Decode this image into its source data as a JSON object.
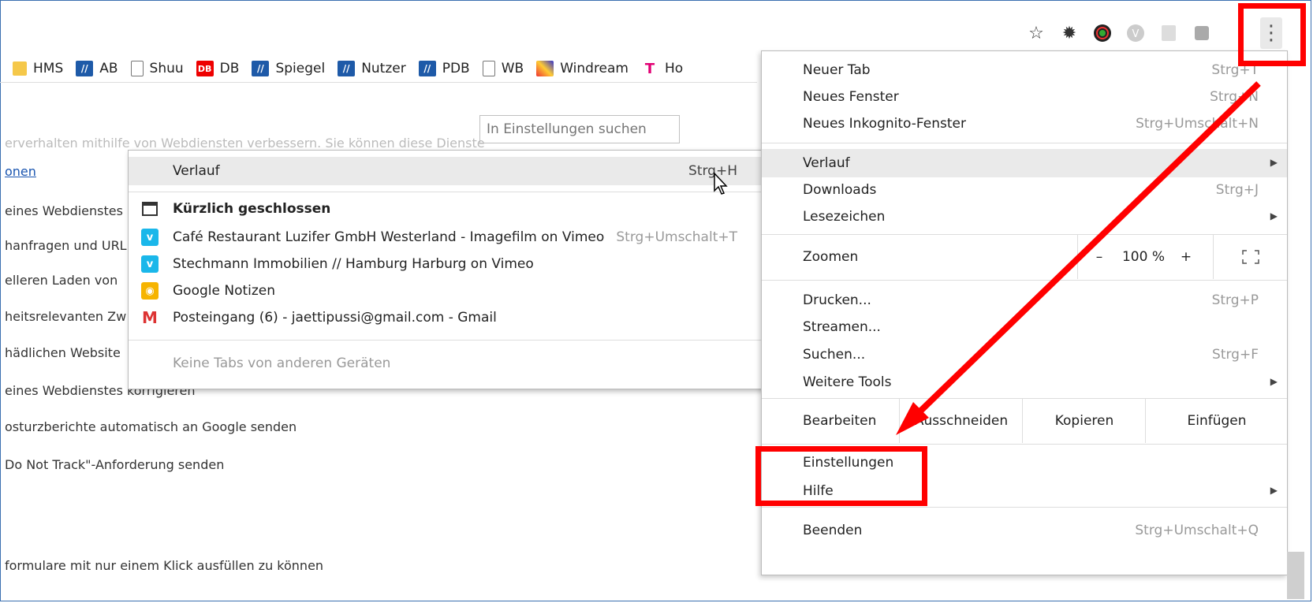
{
  "toolbar": {
    "icons": [
      "star-icon",
      "gear-icon",
      "color-wheel-icon",
      "extension-v-icon",
      "extension-keep-icon",
      "extension-square-icon"
    ],
    "menu_icon": "three-dots-icon"
  },
  "bookmarks": [
    {
      "label": "HMS",
      "icon": "folder-icon"
    },
    {
      "label": "AB",
      "icon": "ab-icon"
    },
    {
      "label": "Shuu",
      "icon": "page-icon"
    },
    {
      "label": "DB",
      "icon": "db-icon"
    },
    {
      "label": "Spiegel",
      "icon": "ab-icon"
    },
    {
      "label": "Nutzer",
      "icon": "ab-icon"
    },
    {
      "label": "PDB",
      "icon": "ab-icon"
    },
    {
      "label": "WB",
      "icon": "page-icon"
    },
    {
      "label": "Windream",
      "icon": "windream-icon"
    },
    {
      "label": "Ho",
      "icon": "telekom-icon"
    }
  ],
  "settings": {
    "search_placeholder": "In Einstellungen suchen",
    "lines": [
      "erverhalten mithilfe von Webdiensten verbessern. Sie können diese Dienste",
      "onen",
      "eines Webdienstes",
      "hanfragen und URL",
      "elleren Laden von",
      "heitsrelevanten Zw",
      "hädlichen Website",
      "eines Webdienstes korrigieren",
      "osturzberichte automatisch an Google senden",
      "Do Not Track\"-Anforderung senden",
      "formulare mit nur einem Klick ausfüllen zu können"
    ]
  },
  "history_submenu": {
    "header_label": "Verlauf",
    "header_shortcut": "Strg+H",
    "recently_closed_label": "Kürzlich geschlossen",
    "items": [
      {
        "label": "Café Restaurant Luzifer GmbH Westerland - Imagefilm on Vimeo",
        "shortcut": "Strg+Umschalt+T",
        "icon": "vimeo-icon"
      },
      {
        "label": "Stechmann Immobilien // Hamburg Harburg on Vimeo",
        "shortcut": "",
        "icon": "vimeo-icon"
      },
      {
        "label": "Google Notizen",
        "shortcut": "",
        "icon": "keep-icon"
      },
      {
        "label": "Posteingang (6) - jaettipussi@gmail.com - Gmail",
        "shortcut": "",
        "icon": "gmail-icon"
      }
    ],
    "no_tabs_label": "Keine Tabs von anderen Geräten"
  },
  "main_menu": {
    "new_tab": {
      "label": "Neuer Tab",
      "shortcut": "Strg+T"
    },
    "new_window": {
      "label": "Neues Fenster",
      "shortcut": "Strg+N"
    },
    "incognito": {
      "label": "Neues Inkognito-Fenster",
      "shortcut": "Strg+Umschalt+N"
    },
    "history": {
      "label": "Verlauf"
    },
    "downloads": {
      "label": "Downloads",
      "shortcut": "Strg+J"
    },
    "bookmarks": {
      "label": "Lesezeichen"
    },
    "zoom": {
      "label": "Zoomen",
      "minus": "–",
      "value": "100 %",
      "plus": "+",
      "fullscreen_icon": "fullscreen-icon"
    },
    "print": {
      "label": "Drucken...",
      "shortcut": "Strg+P"
    },
    "cast": {
      "label": "Streamen..."
    },
    "find": {
      "label": "Suchen...",
      "shortcut": "Strg+F"
    },
    "more_tools": {
      "label": "Weitere Tools"
    },
    "edit": {
      "label": "Bearbeiten",
      "cut": "Ausschneiden",
      "copy": "Kopieren",
      "paste": "Einfügen"
    },
    "settings": {
      "label": "Einstellungen"
    },
    "help": {
      "label": "Hilfe"
    },
    "exit": {
      "label": "Beenden",
      "shortcut": "Strg+Umschalt+Q"
    }
  },
  "colors": {
    "annotation_red": "#ff0000",
    "frame_blue": "#3a6fb0",
    "highlight": "#eaeaea"
  }
}
